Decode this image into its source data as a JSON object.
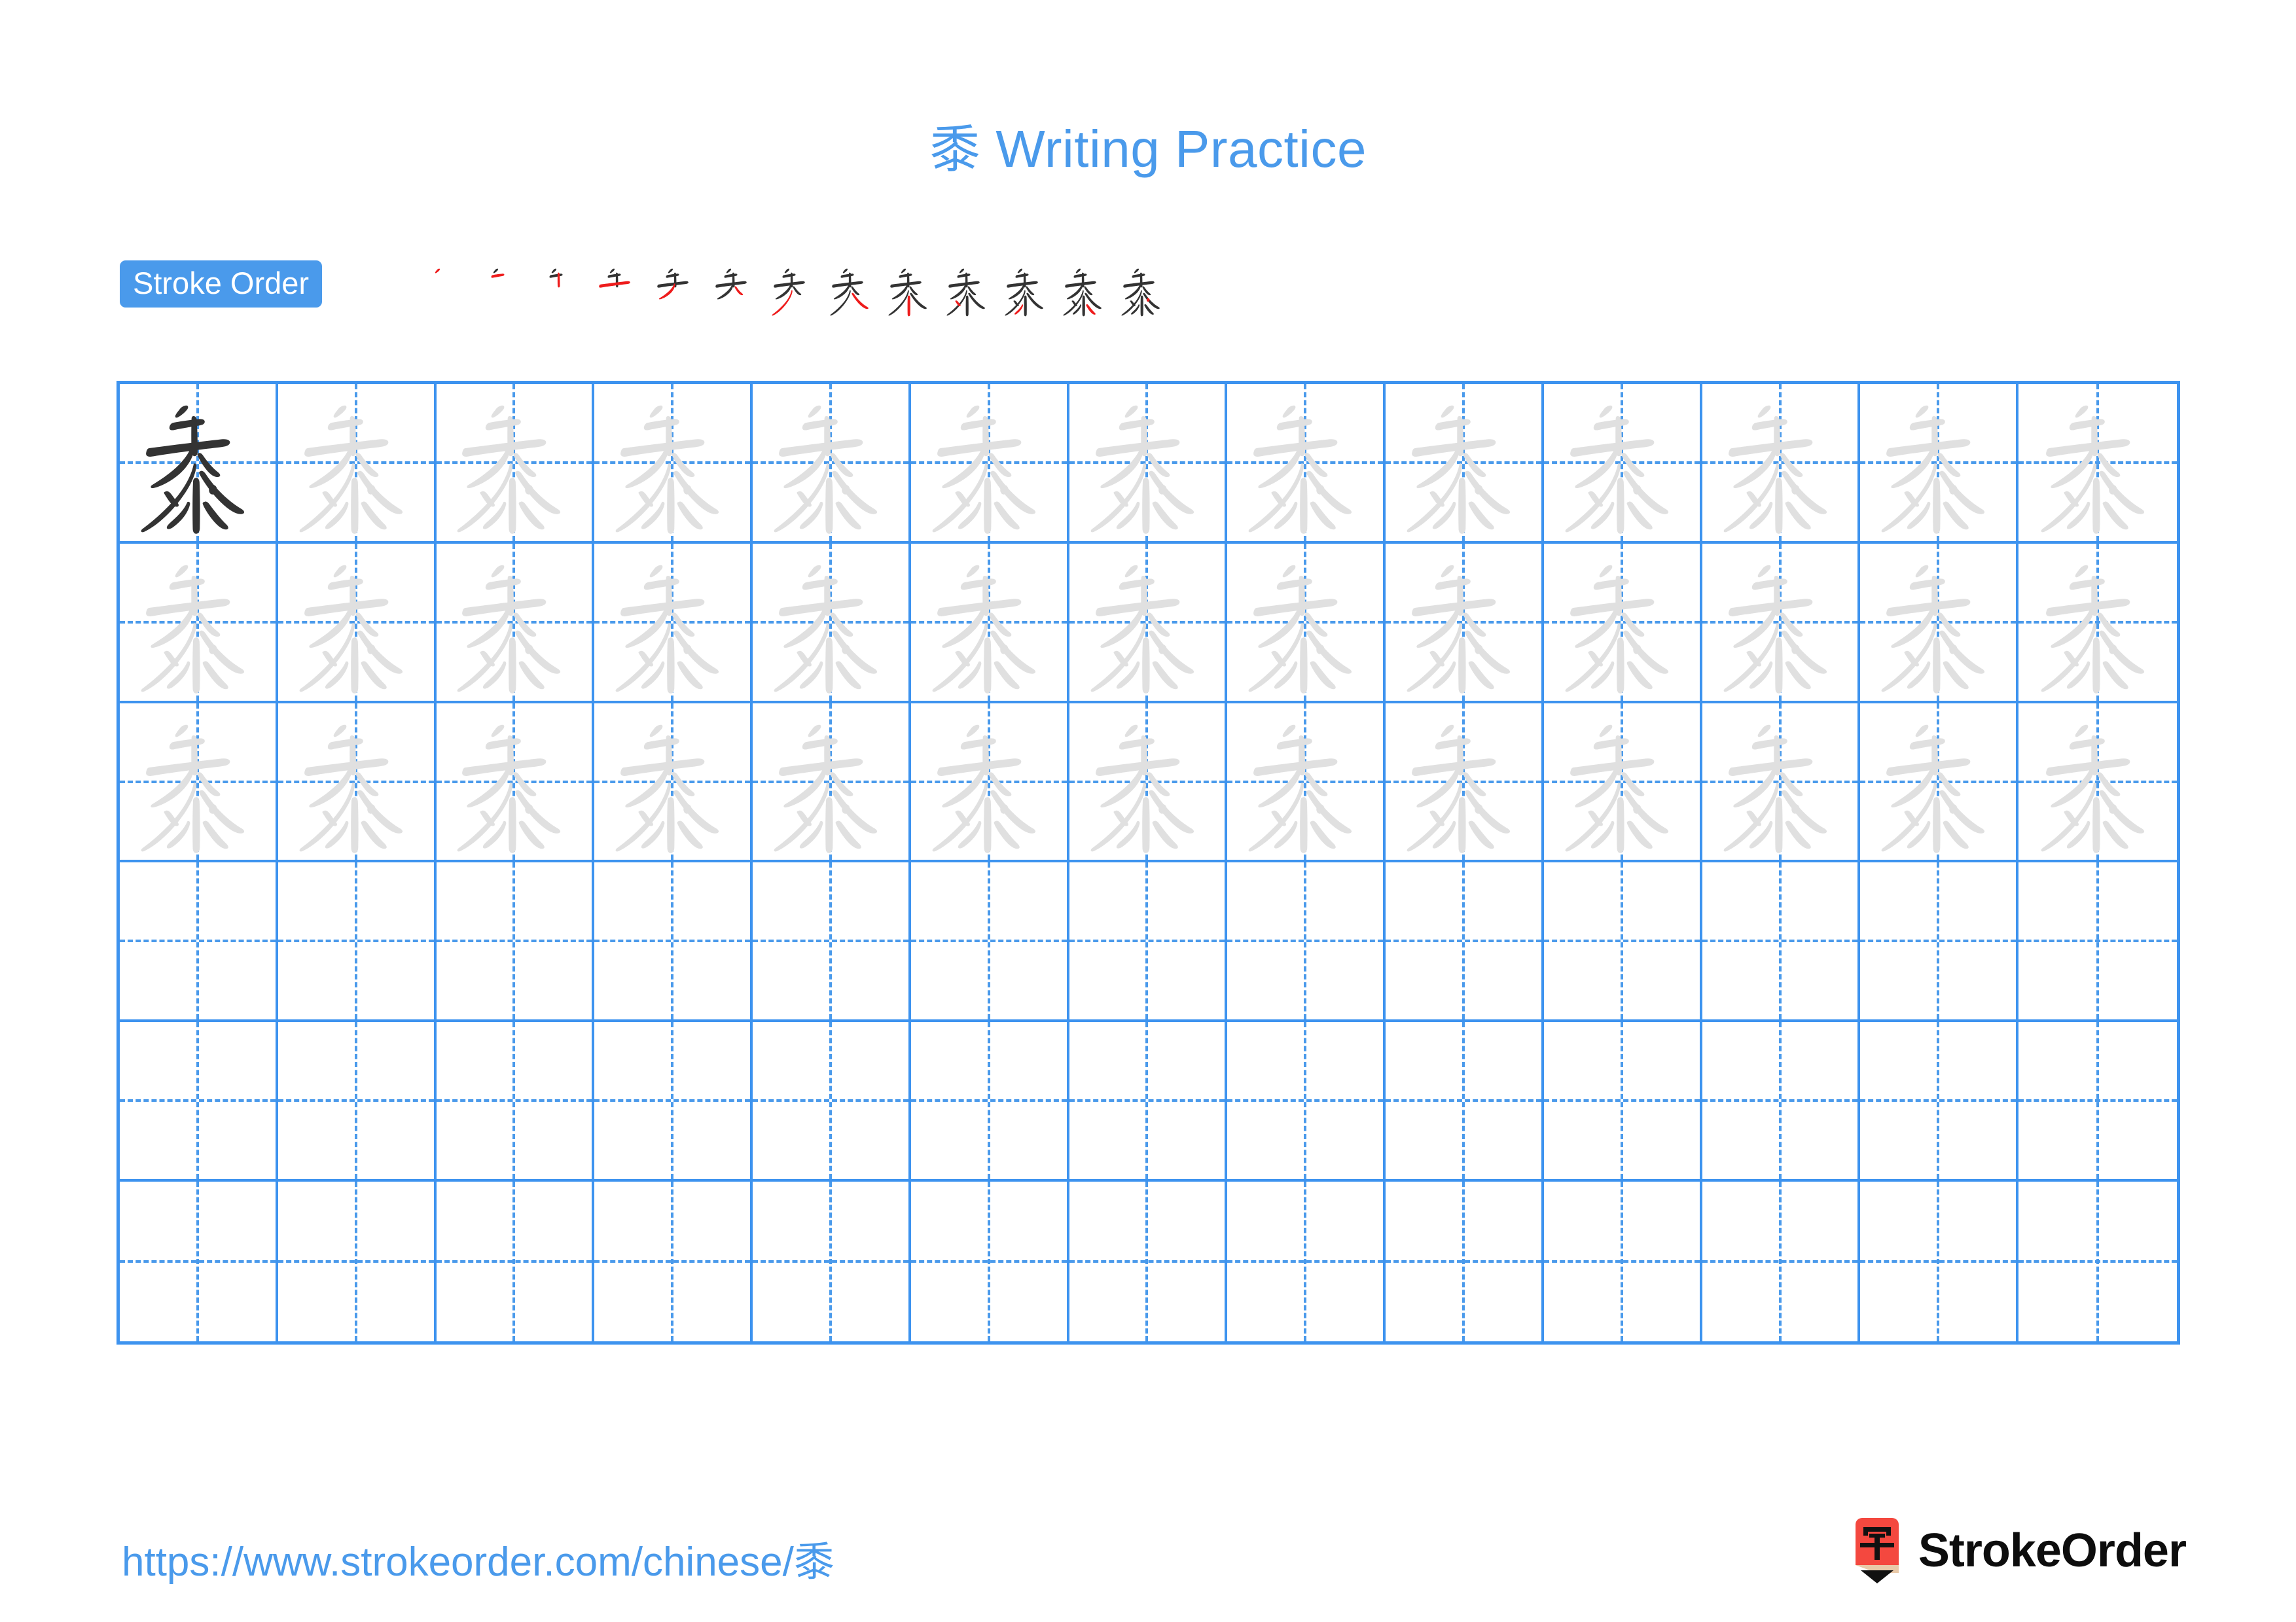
{
  "page": {
    "character": "黍",
    "background_color": "#ffffff",
    "accent_color": "#4a9aeb",
    "grid_line_color": "#3d93ef",
    "model_stroke_color": "#333333",
    "trace_stroke_color": "#e0e0e0",
    "highlight_stroke_color": "#ee1c1c"
  },
  "header": {
    "title_character": "黍",
    "title_text": " Writing Practice",
    "title_full": "黍 Writing Practice"
  },
  "stroke_order": {
    "badge_label": "Stroke Order",
    "total_strokes": 13,
    "steps": [
      {
        "index": 1,
        "strokes_shown": 1,
        "new_stroke": 1
      },
      {
        "index": 2,
        "strokes_shown": 2,
        "new_stroke": 2
      },
      {
        "index": 3,
        "strokes_shown": 3,
        "new_stroke": 3
      },
      {
        "index": 4,
        "strokes_shown": 4,
        "new_stroke": 4
      },
      {
        "index": 5,
        "strokes_shown": 5,
        "new_stroke": 5
      },
      {
        "index": 6,
        "strokes_shown": 6,
        "new_stroke": 6
      },
      {
        "index": 7,
        "strokes_shown": 7,
        "new_stroke": 7
      },
      {
        "index": 8,
        "strokes_shown": 8,
        "new_stroke": 8
      },
      {
        "index": 9,
        "strokes_shown": 9,
        "new_stroke": 9
      },
      {
        "index": 10,
        "strokes_shown": 10,
        "new_stroke": 10
      },
      {
        "index": 11,
        "strokes_shown": 11,
        "new_stroke": 11
      },
      {
        "index": 12,
        "strokes_shown": 12,
        "new_stroke": 12
      },
      {
        "index": 13,
        "strokes_shown": 13,
        "new_stroke": 13
      }
    ]
  },
  "practice_grid": {
    "columns": 13,
    "rows": 6,
    "cells": [
      [
        "model",
        "trace",
        "trace",
        "trace",
        "trace",
        "trace",
        "trace",
        "trace",
        "trace",
        "trace",
        "trace",
        "trace",
        "trace"
      ],
      [
        "trace",
        "trace",
        "trace",
        "trace",
        "trace",
        "trace",
        "trace",
        "trace",
        "trace",
        "trace",
        "trace",
        "trace",
        "trace"
      ],
      [
        "trace",
        "trace",
        "trace",
        "trace",
        "trace",
        "trace",
        "trace",
        "trace",
        "trace",
        "trace",
        "trace",
        "trace",
        "trace"
      ],
      [
        "empty",
        "empty",
        "empty",
        "empty",
        "empty",
        "empty",
        "empty",
        "empty",
        "empty",
        "empty",
        "empty",
        "empty",
        "empty"
      ],
      [
        "empty",
        "empty",
        "empty",
        "empty",
        "empty",
        "empty",
        "empty",
        "empty",
        "empty",
        "empty",
        "empty",
        "empty",
        "empty"
      ],
      [
        "empty",
        "empty",
        "empty",
        "empty",
        "empty",
        "empty",
        "empty",
        "empty",
        "empty",
        "empty",
        "empty",
        "empty",
        "empty"
      ]
    ]
  },
  "footer": {
    "url_prefix": "https://www.strokeorder.com/chinese/",
    "url_character": "黍",
    "url_full": "https://www.strokeorder.com/chinese/黍",
    "brand_name": "StrokeOrder",
    "brand_mark_character": "字",
    "brand_mark_color": "#f4483f"
  }
}
